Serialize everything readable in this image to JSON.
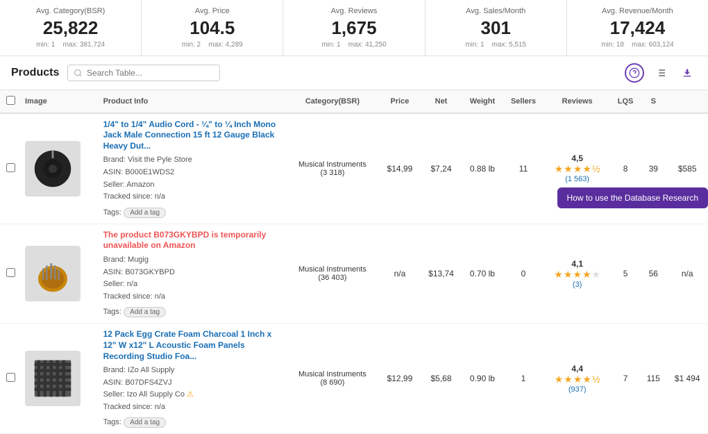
{
  "stats": [
    {
      "label": "Avg. Category(BSR)",
      "value": "25,822",
      "min": "min: 1",
      "max": "max: 381,724"
    },
    {
      "label": "Avg. Price",
      "value": "104.5",
      "min": "min: 2",
      "max": "max: 4,289"
    },
    {
      "label": "Avg. Reviews",
      "value": "1,675",
      "min": "min: 1",
      "max": "max: 41,250"
    },
    {
      "label": "Avg. Sales/Month",
      "value": "301",
      "min": "min: 1",
      "max": "max: 5,515"
    },
    {
      "label": "Avg. Revenue/Month",
      "value": "17,424",
      "min": "min: 18",
      "max": "max: 603,124"
    }
  ],
  "toolbar": {
    "title": "Products",
    "search_placeholder": "Search Table..."
  },
  "tooltip": "How to use the Database Research",
  "table": {
    "headers": [
      "",
      "Image",
      "Product Info",
      "Category(BSR)",
      "Price",
      "Net",
      "Weight",
      "Sellers",
      "Reviews",
      "LQS",
      "S",
      ""
    ],
    "rows": [
      {
        "title": "1/4\" to 1/4\" Audio Cord - ¼\" to ¼ Inch Mono Jack Male Connection 15 ft 12 Gauge Black Heavy Dut...",
        "brand": "Brand:  Visit the Pyle Store",
        "asin": "ASIN:  B000E1WDS2",
        "seller": "Seller:  Amazon",
        "tracked": "Tracked since:  n/a",
        "tag": "Add a tag",
        "category": "Musical Instruments",
        "bsr": "(3 318)",
        "price": "$14,99",
        "net": "$7,24",
        "weight": "0.88 lb",
        "sellers": "11",
        "rating": "4,5",
        "stars": [
          1,
          1,
          1,
          1,
          0.5
        ],
        "reviews": "1 563",
        "lqs": "8",
        "s": "39",
        "revenue": "$585",
        "img_type": "cable"
      },
      {
        "title": "The product B073GKYBPD is temporarily unavailable on Amazon",
        "title_unavailable": true,
        "brand": "Brand:  Mugig",
        "asin": "ASIN:  B073GKYBPD",
        "seller": "Seller:  n/a",
        "tracked": "Tracked since:  n/a",
        "tag": "Add a tag",
        "category": "Musical Instruments",
        "bsr": "(36 403)",
        "price": "n/a",
        "net": "$13,74",
        "weight": "0.70 lb",
        "sellers": "0",
        "rating": "4,1",
        "stars": [
          1,
          1,
          1,
          1,
          0
        ],
        "reviews": "3",
        "lqs": "5",
        "s": "56",
        "revenue": "n/a",
        "img_type": "kalimba"
      },
      {
        "title": "12 Pack Egg Crate Foam Charcoal 1 Inch x 12\" W x12\" L Acoustic Foam Panels Recording Studio Foa...",
        "brand": "Brand:  IZo All Supply",
        "asin": "ASIN:  B07DFS4ZVJ",
        "seller": "Seller:  Izo All Supply Co",
        "tracked": "Tracked since:  n/a",
        "tag": "Add a tag",
        "category": "Musical Instruments",
        "bsr": "(8 690)",
        "price": "$12,99",
        "net": "$5,68",
        "weight": "0.90 lb",
        "sellers": "1",
        "rating": "4,4",
        "stars": [
          1,
          1,
          1,
          1,
          0.5
        ],
        "reviews": "937",
        "lqs": "7",
        "s": "115",
        "revenue": "$1 494",
        "img_type": "foam"
      }
    ]
  }
}
